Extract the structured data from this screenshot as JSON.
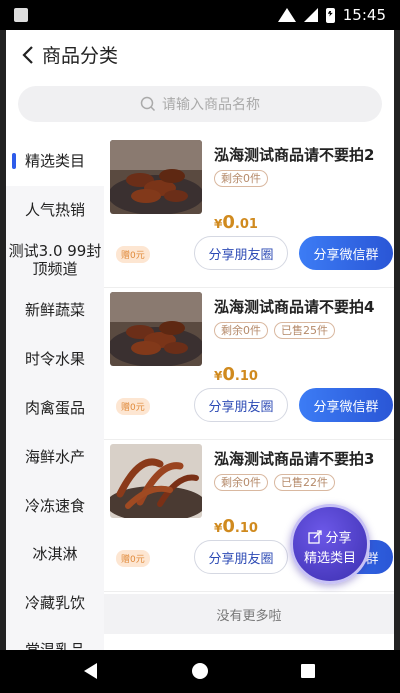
{
  "status_bar": {
    "time": "15:45"
  },
  "header": {
    "title": "商品分类"
  },
  "search": {
    "placeholder": "请输入商品名称"
  },
  "sidebar": {
    "items": [
      {
        "label": "精选类目",
        "active": true
      },
      {
        "label": "人气热销"
      },
      {
        "label": "测试3.0 99封顶频道"
      },
      {
        "label": "新鲜蔬菜"
      },
      {
        "label": "时令水果"
      },
      {
        "label": "肉禽蛋品"
      },
      {
        "label": "海鲜水产"
      },
      {
        "label": "冷冻速食"
      },
      {
        "label": "冰淇淋"
      },
      {
        "label": "冷藏乳饮"
      },
      {
        "label": "常温乳品"
      }
    ]
  },
  "products": [
    {
      "title": "泓海测试商品请不要拍2",
      "tags": [
        "剩余0件"
      ],
      "price_symbol": "¥",
      "price_int": "0",
      "price_dec": ".01",
      "gift": "赠0元",
      "share_friends": "分享朋友圈",
      "share_wechat": "分享微信群"
    },
    {
      "title": "泓海测试商品请不要拍4",
      "tags": [
        "剩余0件",
        "已售25件"
      ],
      "price_symbol": "¥",
      "price_int": "0",
      "price_dec": ".10",
      "gift": "赠0元",
      "share_friends": "分享朋友圈",
      "share_wechat": "分享微信群"
    },
    {
      "title": "泓海测试商品请不要拍3",
      "tags": [
        "剩余0件",
        "已售22件"
      ],
      "price_symbol": "¥",
      "price_int": "0",
      "price_dec": ".10",
      "gift": "赠0元",
      "share_friends": "分享朋友圈",
      "share_wechat": "分享微信群"
    }
  ],
  "footer": {
    "no_more": "没有更多啦"
  },
  "float_share": {
    "line1": "分享",
    "line2": "精选类目"
  },
  "colors": {
    "accent": "#2d5bea",
    "price": "#d08a1e",
    "float": "#4b3cc8"
  }
}
